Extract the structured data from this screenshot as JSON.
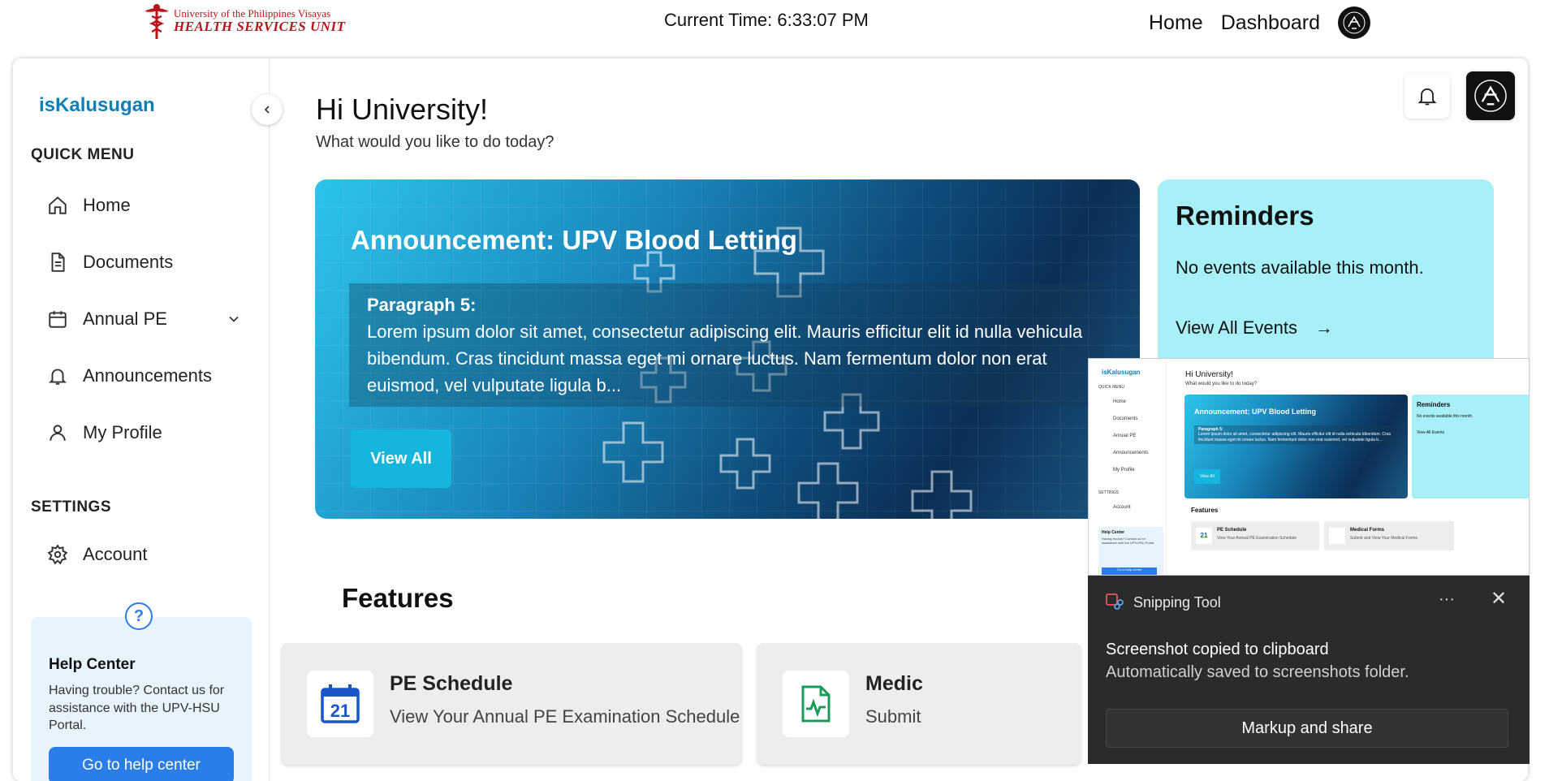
{
  "topbar": {
    "org_line1": "University of the Philippines Visayas",
    "org_line2": "HEALTH SERVICES UNIT",
    "current_time": "Current Time: 6:33:07 PM",
    "nav": [
      "Home",
      "Dashboard"
    ]
  },
  "sidebar": {
    "brand": "isKalusugan",
    "quick_menu_title": "QUICK MENU",
    "items": [
      {
        "label": "Home",
        "icon": "home-icon"
      },
      {
        "label": "Documents",
        "icon": "document-icon"
      },
      {
        "label": "Annual PE",
        "icon": "calendar-icon"
      },
      {
        "label": "Announcements",
        "icon": "bell-icon"
      },
      {
        "label": "My Profile",
        "icon": "user-icon"
      }
    ],
    "settings_title": "SETTINGS",
    "settings_items": [
      {
        "label": "Account",
        "icon": "gear-icon"
      }
    ],
    "help": {
      "title": "Help Center",
      "text": "Having trouble? Contact us for assistance with the UPV-HSU Portal.",
      "button": "Go to help center"
    }
  },
  "main": {
    "greeting": "Hi University!",
    "subtitle": "What would you like to do today?",
    "announcement": {
      "title": "Announcement: UPV Blood Letting",
      "paragraph_heading": "Paragraph 5:",
      "paragraph_text": "Lorem ipsum dolor sit amet, consectetur adipiscing elit. Mauris efficitur elit id nulla vehicula bibendum. Cras tincidunt massa eget mi ornare luctus. Nam fermentum dolor non erat euismod, vel vulputate ligula b...",
      "button": "View All"
    },
    "reminders": {
      "title": "Reminders",
      "empty": "No events available this month.",
      "link": "View All Events",
      "link_arrow": "→"
    },
    "features_title": "Features",
    "features": [
      {
        "title": "PE Schedule",
        "desc": "View Your Annual PE Examination Schedule",
        "icon": "calendar-21-icon",
        "icon_day": "21"
      },
      {
        "title": "Medic",
        "desc": "Submit",
        "icon": "medical-form-icon"
      }
    ]
  },
  "snipping_tool": {
    "app_name": "Snipping Tool",
    "more": "···",
    "close": "✕",
    "message": "Screenshot copied to clipboard",
    "detail": "Automatically saved to screenshots folder.",
    "button": "Markup and share",
    "preview": {
      "brand": "isKalusugan",
      "greeting": "Hi University!",
      "subtitle": "What would you like to do today?",
      "quick_menu": "QUICK MENU",
      "items": [
        "Home",
        "Documents",
        "Annual PE",
        "Announcements",
        "My Profile"
      ],
      "settings": "SETTINGS",
      "account": "Account",
      "help_title": "Help Center",
      "help_text": "Having trouble? Contact us for assistance with the UPV-HSU Portal.",
      "help_button": "Go to help center",
      "announcement": "Announcement: UPV Blood Letting",
      "paragraph_heading": "Paragraph 5:",
      "paragraph_text": "Lorem ipsum dolor sit amet, consectetur adipiscing elit. Mauris efficitur elit id nulla vehicula bibendum. Cras tincidunt massa eget mi ornare luctus. Nam fermentum dolor non erat euismod, vel vulputate ligula b...",
      "view_all": "View All",
      "reminders": "Reminders",
      "empty": "No events available this month.",
      "events_link": "View All Events",
      "features": "Features",
      "f1_title": "PE Schedule",
      "f1_desc": "View Your Annual PE Examination Schedule",
      "f1_day": "21",
      "f2_title": "Medical Forms",
      "f2_desc": "Submit and View Your Medical Forms"
    }
  }
}
